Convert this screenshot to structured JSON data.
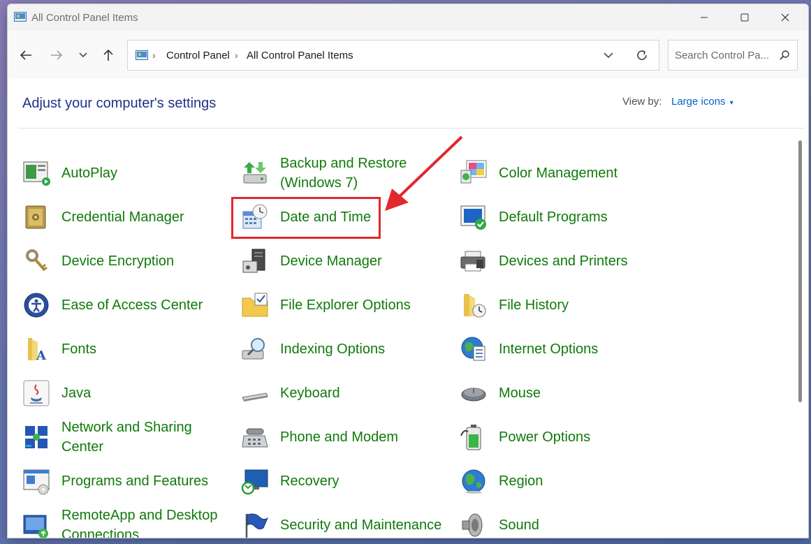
{
  "window": {
    "title": "All Control Panel Items"
  },
  "address": {
    "crumbs": [
      "Control Panel",
      "All Control Panel Items"
    ],
    "search_placeholder": "Search Control Pa..."
  },
  "heading": "Adjust your computer's settings",
  "view_by": {
    "label": "View by:",
    "value": "Large icons"
  },
  "items": [
    {
      "label": "AutoPlay",
      "icon": "autoplay-icon"
    },
    {
      "label": "Backup and Restore (Windows 7)",
      "icon": "backup-icon"
    },
    {
      "label": "Color Management",
      "icon": "color-management-icon"
    },
    {
      "label": "Credential Manager",
      "icon": "credential-safe-icon"
    },
    {
      "label": "Date and Time",
      "icon": "calendar-clock-icon"
    },
    {
      "label": "Default Programs",
      "icon": "default-programs-icon"
    },
    {
      "label": "Device Encryption",
      "icon": "keys-icon"
    },
    {
      "label": "Device Manager",
      "icon": "device-manager-icon"
    },
    {
      "label": "Devices and Printers",
      "icon": "printer-icon"
    },
    {
      "label": "Ease of Access Center",
      "icon": "ease-of-access-icon"
    },
    {
      "label": "File Explorer Options",
      "icon": "folder-check-icon"
    },
    {
      "label": "File History",
      "icon": "file-history-icon"
    },
    {
      "label": "Fonts",
      "icon": "fonts-folder-icon"
    },
    {
      "label": "Indexing Options",
      "icon": "indexing-icon"
    },
    {
      "label": "Internet Options",
      "icon": "globe-icon"
    },
    {
      "label": "Java",
      "icon": "java-icon"
    },
    {
      "label": "Keyboard",
      "icon": "keyboard-icon"
    },
    {
      "label": "Mouse",
      "icon": "mouse-icon"
    },
    {
      "label": "Network and Sharing Center",
      "icon": "network-icon"
    },
    {
      "label": "Phone and Modem",
      "icon": "phone-icon"
    },
    {
      "label": "Power Options",
      "icon": "battery-icon"
    },
    {
      "label": "Programs and Features",
      "icon": "programs-icon"
    },
    {
      "label": "Recovery",
      "icon": "recovery-icon"
    },
    {
      "label": "Region",
      "icon": "region-globe-icon"
    },
    {
      "label": "RemoteApp and Desktop Connections",
      "icon": "remote-desktop-icon"
    },
    {
      "label": "Security and Maintenance",
      "icon": "flag-icon"
    },
    {
      "label": "Sound",
      "icon": "speaker-icon"
    }
  ],
  "colors": {
    "link_green": "#107a0a",
    "heading_blue": "#1e3287",
    "annotation_red": "#e1282d"
  }
}
